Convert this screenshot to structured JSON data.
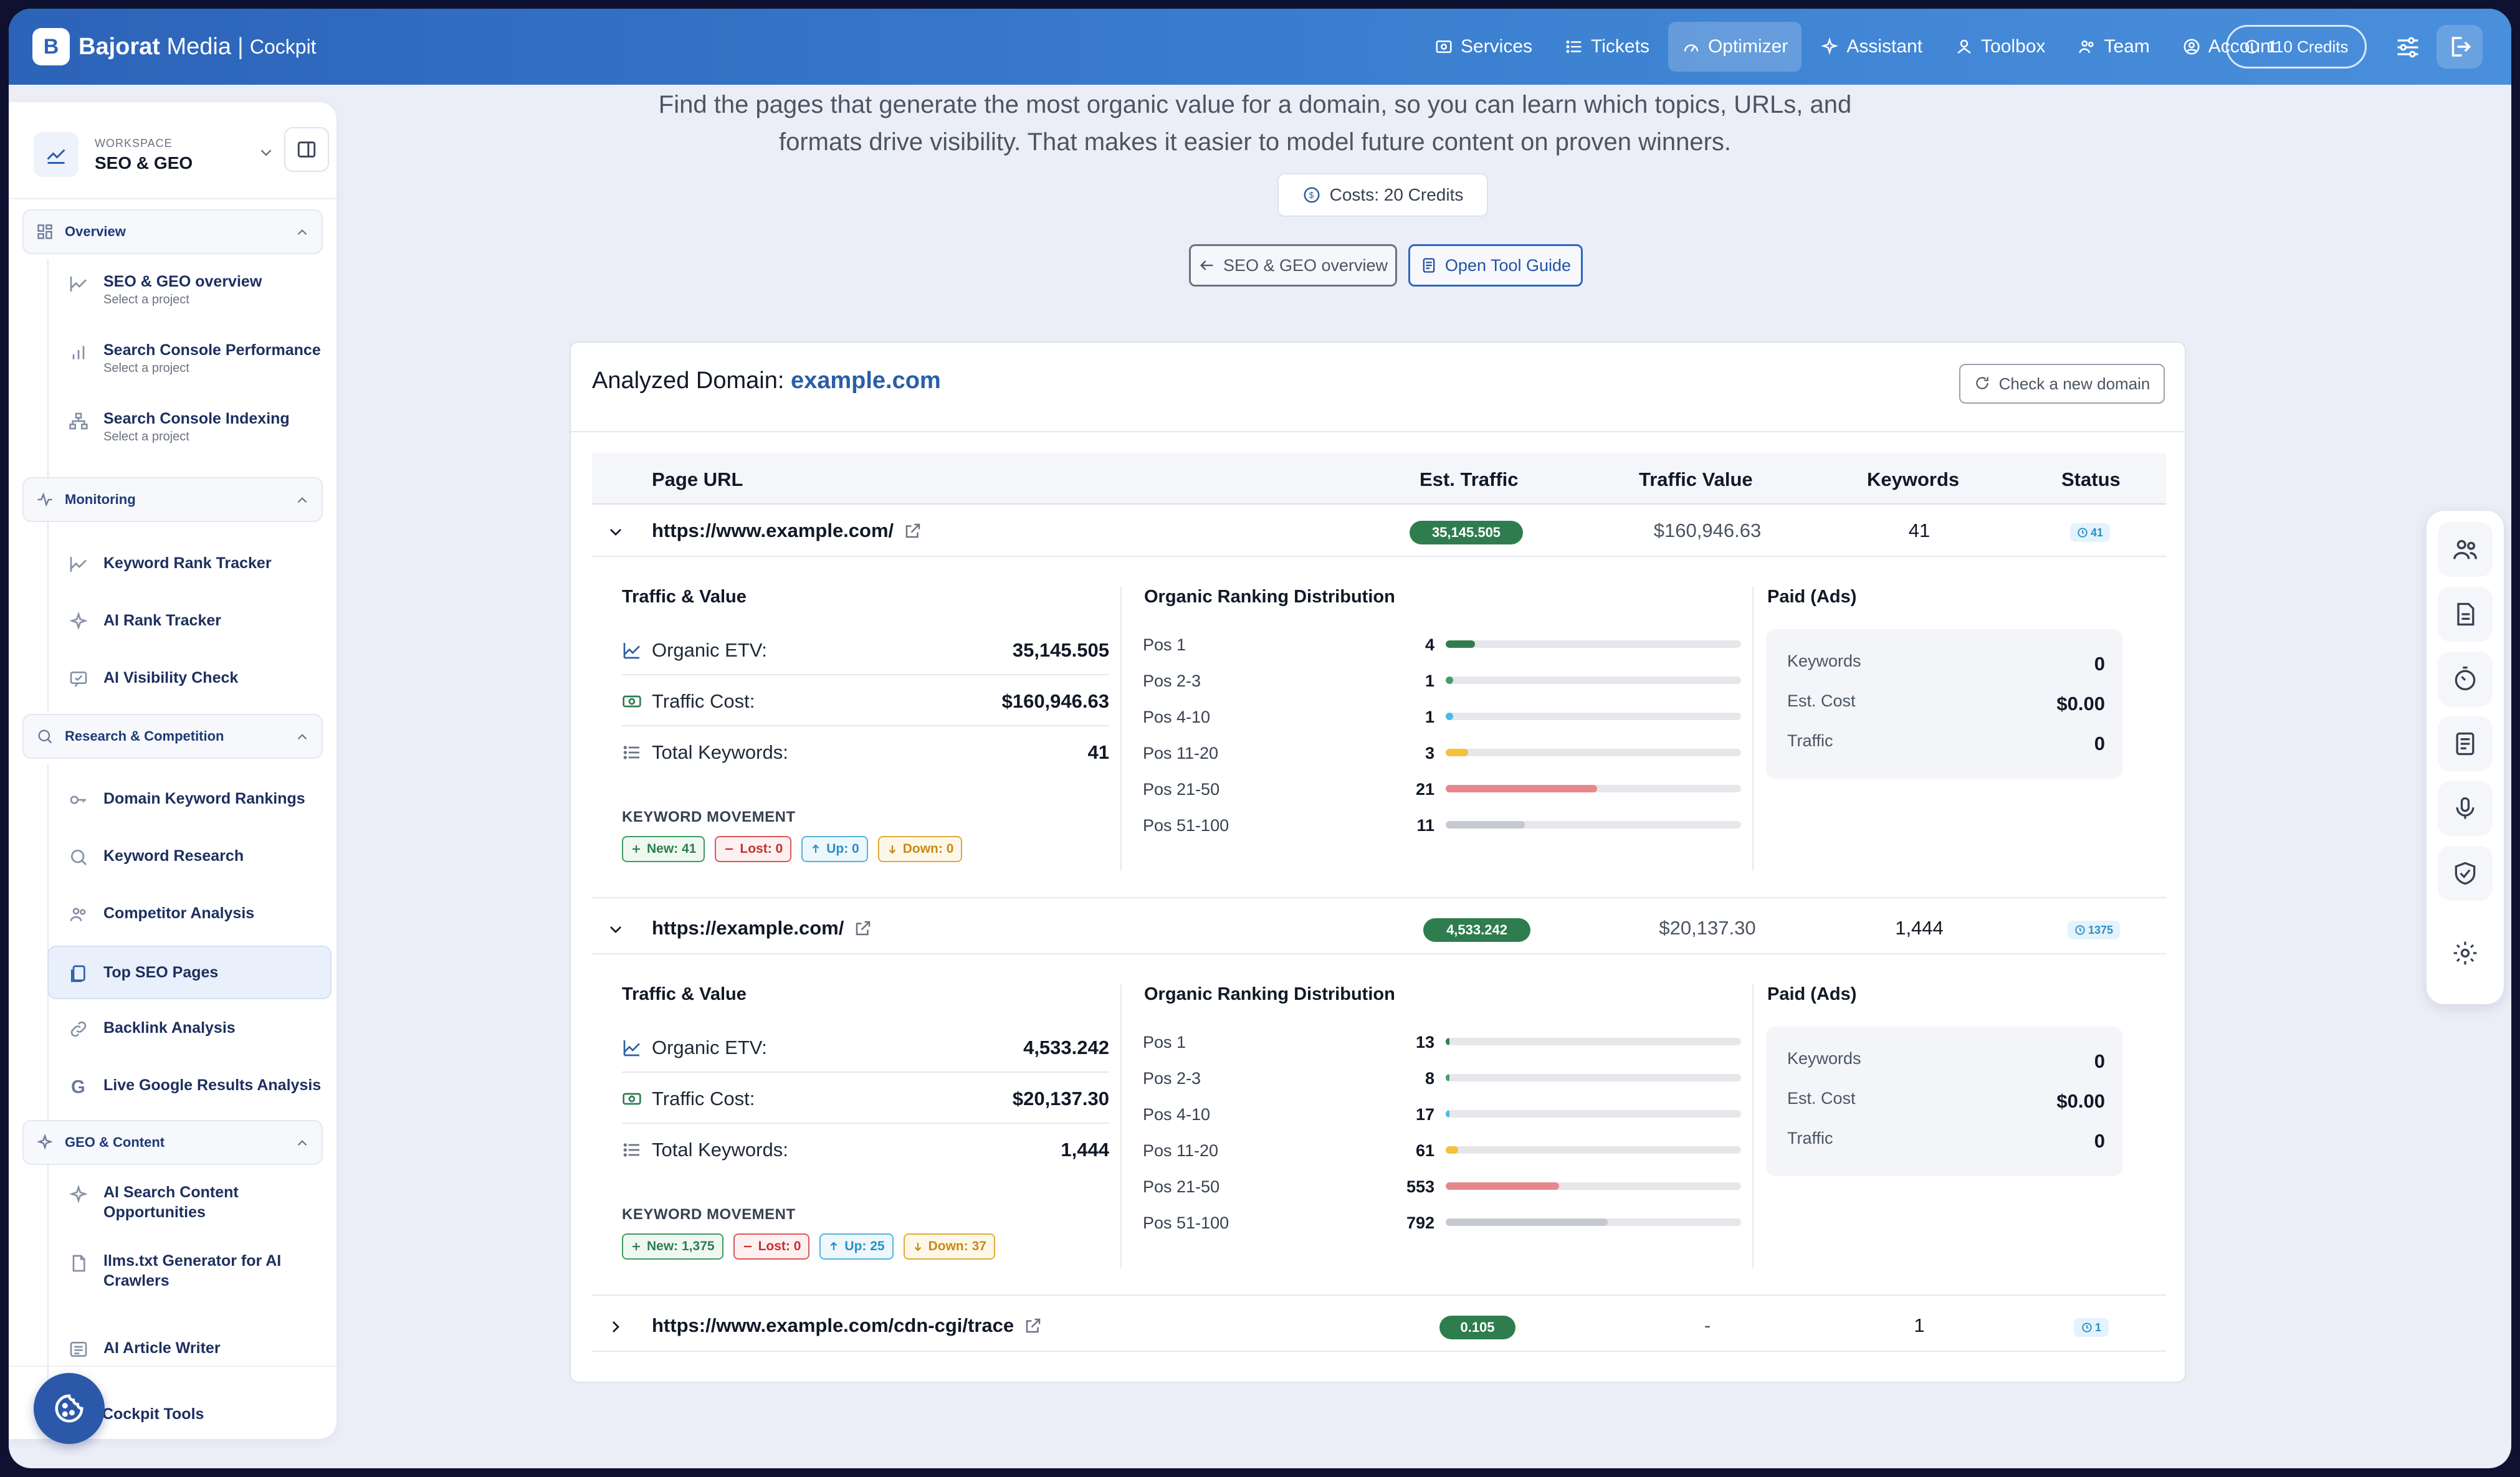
{
  "brand": {
    "name_bold": "Bajorat",
    "name_light": "Media",
    "sub": "Cockpit"
  },
  "nav": [
    {
      "label": "Services",
      "icon": "services-icon"
    },
    {
      "label": "Tickets",
      "icon": "tickets-icon"
    },
    {
      "label": "Optimizer",
      "icon": "gauge-icon",
      "active": true
    },
    {
      "label": "Assistant",
      "icon": "sparkle-icon"
    },
    {
      "label": "Toolbox",
      "icon": "toolbox-icon"
    },
    {
      "label": "Team",
      "icon": "team-icon"
    },
    {
      "label": "Account",
      "icon": "account-icon"
    }
  ],
  "credits_label": "110 Credits",
  "workspace": {
    "label": "WORKSPACE",
    "name": "SEO & GEO"
  },
  "sidebar": {
    "groups": [
      {
        "title": "Overview",
        "items": [
          {
            "title": "SEO & GEO overview",
            "sub": "Select a project"
          },
          {
            "title": "Search Console Performance",
            "sub": "Select a project"
          },
          {
            "title": "Search Console Indexing",
            "sub": "Select a project"
          }
        ]
      },
      {
        "title": "Monitoring",
        "items": [
          {
            "title": "Keyword Rank Tracker"
          },
          {
            "title": "AI Rank Tracker"
          },
          {
            "title": "AI Visibility Check"
          }
        ]
      },
      {
        "title": "Research & Competition",
        "items": [
          {
            "title": "Domain Keyword Rankings"
          },
          {
            "title": "Keyword Research"
          },
          {
            "title": "Competitor Analysis"
          },
          {
            "title": "Top SEO Pages"
          },
          {
            "title": "Backlink Analysis"
          },
          {
            "title": "Live Google Results Analysis"
          }
        ]
      },
      {
        "title": "GEO & Content",
        "items": [
          {
            "title": "AI Search Content Opportunities"
          },
          {
            "title": "llms.txt Generator for AI Crawlers"
          },
          {
            "title": "AI Article Writer"
          }
        ]
      }
    ],
    "footer_item": "Cockpit Tools"
  },
  "intro": {
    "line1": "Find the pages that generate the most organic value for a domain, so you can learn which topics, URLs, and",
    "line2": "formats drive visibility. That makes it easier to model future content on proven winners."
  },
  "cost_label": "Costs: 20 Credits",
  "back_label": "SEO & GEO overview",
  "guide_label": "Open Tool Guide",
  "card": {
    "title_prefix": "Analyzed Domain:",
    "domain": "example.com",
    "check_label": "Check a new domain"
  },
  "table": {
    "headers": {
      "url": "Page URL",
      "traffic": "Est. Traffic",
      "value": "Traffic Value",
      "keywords": "Keywords",
      "status": "Status"
    },
    "rows": [
      {
        "url": "https://www.example.com/",
        "traffic": "35,145.505",
        "value": "$160,946.63",
        "keywords": "41",
        "status": "41",
        "expanded": true
      },
      {
        "url": "https://example.com/",
        "traffic": "4,533.242",
        "value": "$20,137.30",
        "keywords": "1,444",
        "status": "1375",
        "expanded": true
      },
      {
        "url": "https://www.example.com/cdn-cgi/trace",
        "traffic": "0.105",
        "value": "-",
        "keywords": "1",
        "status": "1",
        "expanded": false
      }
    ]
  },
  "detail_labels": {
    "traffic_value": "Traffic & Value",
    "distribution": "Organic Ranking Distribution",
    "paid": "Paid (Ads)",
    "organic_etv": "Organic ETV:",
    "traffic_cost": "Traffic Cost:",
    "total_keywords": "Total Keywords:",
    "keyword_movement": "KEYWORD MOVEMENT",
    "paid_keywords": "Keywords",
    "paid_cost": "Est. Cost",
    "paid_traffic": "Traffic"
  },
  "details": [
    {
      "organic_etv": "35,145.505",
      "traffic_cost": "$160,946.63",
      "total_keywords": "41",
      "movement": {
        "new": "New: 41",
        "lost": "Lost: 0",
        "up": "Up: 0",
        "down": "Down: 0"
      },
      "distribution": [
        {
          "label": "Pos 1",
          "value": "4",
          "fraction": 0.1,
          "color": "#2f7d4e"
        },
        {
          "label": "Pos 2-3",
          "value": "1",
          "fraction": 0.025,
          "color": "#4a9b69"
        },
        {
          "label": "Pos 4-10",
          "value": "1",
          "fraction": 0.025,
          "color": "#4db8e0"
        },
        {
          "label": "Pos 11-20",
          "value": "3",
          "fraction": 0.075,
          "color": "#f5c13b"
        },
        {
          "label": "Pos 21-50",
          "value": "21",
          "fraction": 0.512,
          "color": "#e8868e"
        },
        {
          "label": "Pos 51-100",
          "value": "11",
          "fraction": 0.268,
          "color": "#c6c9cf"
        }
      ],
      "paid": {
        "keywords": "0",
        "cost": "$0.00",
        "traffic": "0"
      }
    },
    {
      "organic_etv": "4,533.242",
      "traffic_cost": "$20,137.30",
      "total_keywords": "1,444",
      "movement": {
        "new": "New: 1,375",
        "lost": "Lost: 0",
        "up": "Up: 25",
        "down": "Down: 37"
      },
      "distribution": [
        {
          "label": "Pos 1",
          "value": "13",
          "fraction": 0.009,
          "color": "#2f7d4e"
        },
        {
          "label": "Pos 2-3",
          "value": "8",
          "fraction": 0.006,
          "color": "#4a9b69"
        },
        {
          "label": "Pos 4-10",
          "value": "17",
          "fraction": 0.012,
          "color": "#4db8e0"
        },
        {
          "label": "Pos 11-20",
          "value": "61",
          "fraction": 0.042,
          "color": "#f5c13b"
        },
        {
          "label": "Pos 21-50",
          "value": "553",
          "fraction": 0.383,
          "color": "#e8868e"
        },
        {
          "label": "Pos 51-100",
          "value": "792",
          "fraction": 0.548,
          "color": "#c6c9cf"
        }
      ],
      "paid": {
        "keywords": "0",
        "cost": "$0.00",
        "traffic": "0"
      }
    }
  ],
  "float_icons": [
    "team-icon",
    "document-icon",
    "timer-icon",
    "notes-icon",
    "microphone-icon",
    "shield-check-icon",
    "gear-icon"
  ]
}
